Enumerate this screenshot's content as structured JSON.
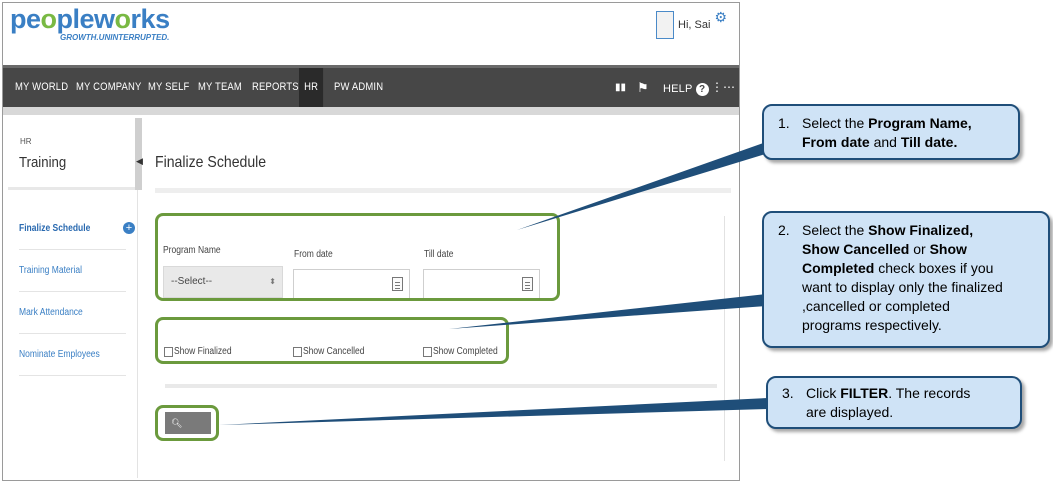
{
  "brand": {
    "logo_part1": "pe",
    "logo_o": "o",
    "logo_part2": "ple",
    "logo_part3": "w",
    "logo_o2": "o",
    "logo_part4": "rks",
    "tagline": "GROWTH.UNINTERRUPTED."
  },
  "user": {
    "greeting": "Hi, Sai"
  },
  "nav": {
    "items": [
      "MY WORLD",
      "MY COMPANY",
      "MY SELF",
      "MY TEAM",
      "REPORTS",
      "HR",
      "PW ADMIN"
    ],
    "active": "HR",
    "help_label": "HELP",
    "icons": [
      "bar-icon",
      "flag-icon",
      "help-icon",
      "share-icon"
    ]
  },
  "sidebar": {
    "section": "HR",
    "title": "Training",
    "items": [
      {
        "label": "Finalize Schedule"
      },
      {
        "label": "Training Material"
      },
      {
        "label": "Mark Attendance"
      },
      {
        "label": "Nominate Employees"
      }
    ]
  },
  "main": {
    "page_title": "Finalize Schedule",
    "fields": {
      "program_name_label": "Program Name",
      "program_name_value": "--Select--",
      "from_date_label": "From date",
      "till_date_label": "Till date"
    },
    "checkboxes": [
      "Show Finalized",
      "Show Cancelled",
      "Show Completed"
    ],
    "filter_label": "FILTER"
  },
  "callouts": [
    {
      "num": "1.",
      "lines": [
        [
          {
            "t": "Select the ",
            "b": false
          },
          {
            "t": "Program Name,",
            "b": true
          }
        ],
        [
          {
            "t": "From date",
            "b": true
          },
          {
            "t": " and ",
            "b": false
          },
          {
            "t": "Till date.",
            "b": true
          }
        ]
      ]
    },
    {
      "num": "2.",
      "lines": [
        [
          {
            "t": "Select the ",
            "b": false
          },
          {
            "t": "Show Finalized,",
            "b": true
          }
        ],
        [
          {
            "t": "Show Cancelled",
            "b": true
          },
          {
            "t": " or ",
            "b": false
          },
          {
            "t": "Show",
            "b": true
          }
        ],
        [
          {
            "t": "Completed",
            "b": true
          },
          {
            "t": " check boxes if you",
            "b": false
          }
        ],
        [
          {
            "t": "want to display only the finalized",
            "b": false
          }
        ],
        [
          {
            "t": ",cancelled or completed",
            "b": false
          }
        ],
        [
          {
            "t": "programs respectively.",
            "b": false
          }
        ]
      ]
    },
    {
      "num": "3.",
      "lines": [
        [
          {
            "t": "Click ",
            "b": false
          },
          {
            "t": "FILTER",
            "b": true
          },
          {
            "t": ". The records",
            "b": false
          }
        ],
        [
          {
            "t": "are displayed.",
            "b": false
          }
        ]
      ]
    }
  ],
  "colors": {
    "nav_bg": "#474747",
    "accent_blue": "#3a7fc4",
    "logo_green": "#79b943",
    "highlight_green": "#6b9a3d",
    "callout_fill": "#cfe3f6",
    "callout_border": "#1f4e79"
  }
}
